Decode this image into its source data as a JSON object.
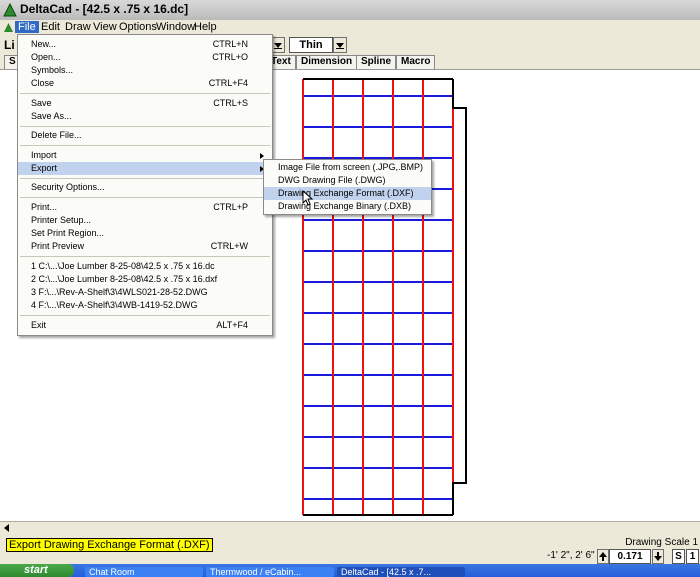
{
  "window": {
    "title": "DeltaCad - [42.5 x .75 x 16.dc]"
  },
  "menubar": [
    "File",
    "Edit",
    "Draw",
    "View",
    "Options",
    "Window",
    "Help"
  ],
  "toolbar": {
    "layer_label": "Li",
    "line_width": "Thin"
  },
  "tabs": [
    "S",
    "Text",
    "Dimension",
    "Spline",
    "Macro"
  ],
  "file_menu": [
    {
      "label": "New...",
      "shortcut": "CTRL+N"
    },
    {
      "label": "Open...",
      "shortcut": "CTRL+O"
    },
    {
      "label": "Symbols...",
      "shortcut": ""
    },
    {
      "label": "Close",
      "shortcut": "CTRL+F4"
    },
    {
      "label": "Save",
      "shortcut": "CTRL+S"
    },
    {
      "label": "Save As...",
      "shortcut": ""
    },
    {
      "label": "Delete File...",
      "shortcut": ""
    },
    {
      "label": "Import",
      "shortcut": ""
    },
    {
      "label": "Export",
      "shortcut": ""
    },
    {
      "label": "Security Options...",
      "shortcut": ""
    },
    {
      "label": "Print...",
      "shortcut": "CTRL+P"
    },
    {
      "label": "Printer Setup...",
      "shortcut": ""
    },
    {
      "label": "Set Print Region...",
      "shortcut": ""
    },
    {
      "label": "Print Preview",
      "shortcut": "CTRL+W"
    },
    {
      "label": "1 C:\\...\\Joe Lumber 8-25-08\\42.5 x .75 x 16.dc",
      "shortcut": ""
    },
    {
      "label": "2 C:\\...\\Joe Lumber 8-25-08\\42.5 x .75 x 16.dxf",
      "shortcut": ""
    },
    {
      "label": "3 F:\\...\\Rev-A-Shelf\\3\\4WLS021-28-52.DWG",
      "shortcut": ""
    },
    {
      "label": "4 F:\\...\\Rev-A-Shelf\\3\\4WB-1419-52.DWG",
      "shortcut": ""
    },
    {
      "label": "Exit",
      "shortcut": "ALT+F4"
    }
  ],
  "export_submenu": [
    "Image File from screen (.JPG,.BMP)",
    "DWG Drawing File (.DWG)",
    "Drawing Exchange Format (.DXF)",
    "Drawing Exchange Binary (.DXB)"
  ],
  "status": {
    "message": "Export Drawing Exchange Format (.DXF)",
    "coords": "-1' 2\", 2' 6\"",
    "drawing_scale_label": "Drawing Scale 1",
    "scale_value": "0.171",
    "s_label": "S",
    "one_label": "1"
  },
  "taskbar": {
    "start": "start",
    "tasks": [
      "Chat Room",
      "Thermwood / eCabin...",
      "DeltaCad - [42.5 x .7..."
    ]
  },
  "colors": {
    "red": "#ee1111",
    "blue": "#1a1add",
    "highlight": "#c1d2ee"
  },
  "grid": {
    "columns": 5,
    "rows": 15
  }
}
